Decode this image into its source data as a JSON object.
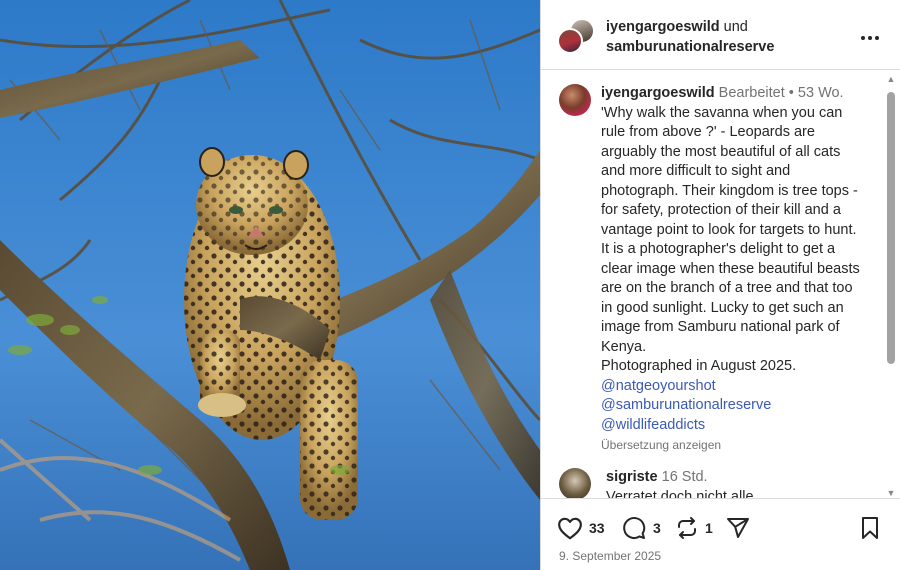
{
  "post": {
    "image_alt": "Leopard on tree branch",
    "header": {
      "user1": "iyengargoeswild",
      "joiner": "und",
      "user2": "samburunationalreserve"
    },
    "caption": {
      "username": "iyengargoeswild",
      "edited": "Bearbeitet",
      "dot": "•",
      "age": "53 Wo.",
      "text": "'Why walk the savanna when you can rule from above ?' - Leopards are arguably the most beautiful of all cats and more difficult to sight and photograph. Their kingdom is tree tops -for safety, protection of their kill and a vantage point to look for targets to hunt. It is a photographer's delight to get a clear image when these beautiful beasts are on the branch of a tree and that too in good sunlight. Lucky to get such an image from Samburu national park of Kenya.",
      "photographed": "Photographed in August 2025.",
      "tags": [
        "@natgeoyourshot",
        "@samburunationalreserve",
        "@wildlifeaddicts"
      ],
      "translate": "Übersetzung anzeigen"
    },
    "comment": {
      "username": "sigriste",
      "age": "16 Std.",
      "text": "Verratet doch nicht alle"
    },
    "actions": {
      "likes": "33",
      "comments": "3",
      "reposts": "1"
    },
    "date": "9. September 2025"
  },
  "icons": [
    "more-icon",
    "heart-icon",
    "comment-icon",
    "repost-icon",
    "share-icon",
    "bookmark-icon",
    "scroll-up-icon",
    "scroll-down-icon"
  ]
}
